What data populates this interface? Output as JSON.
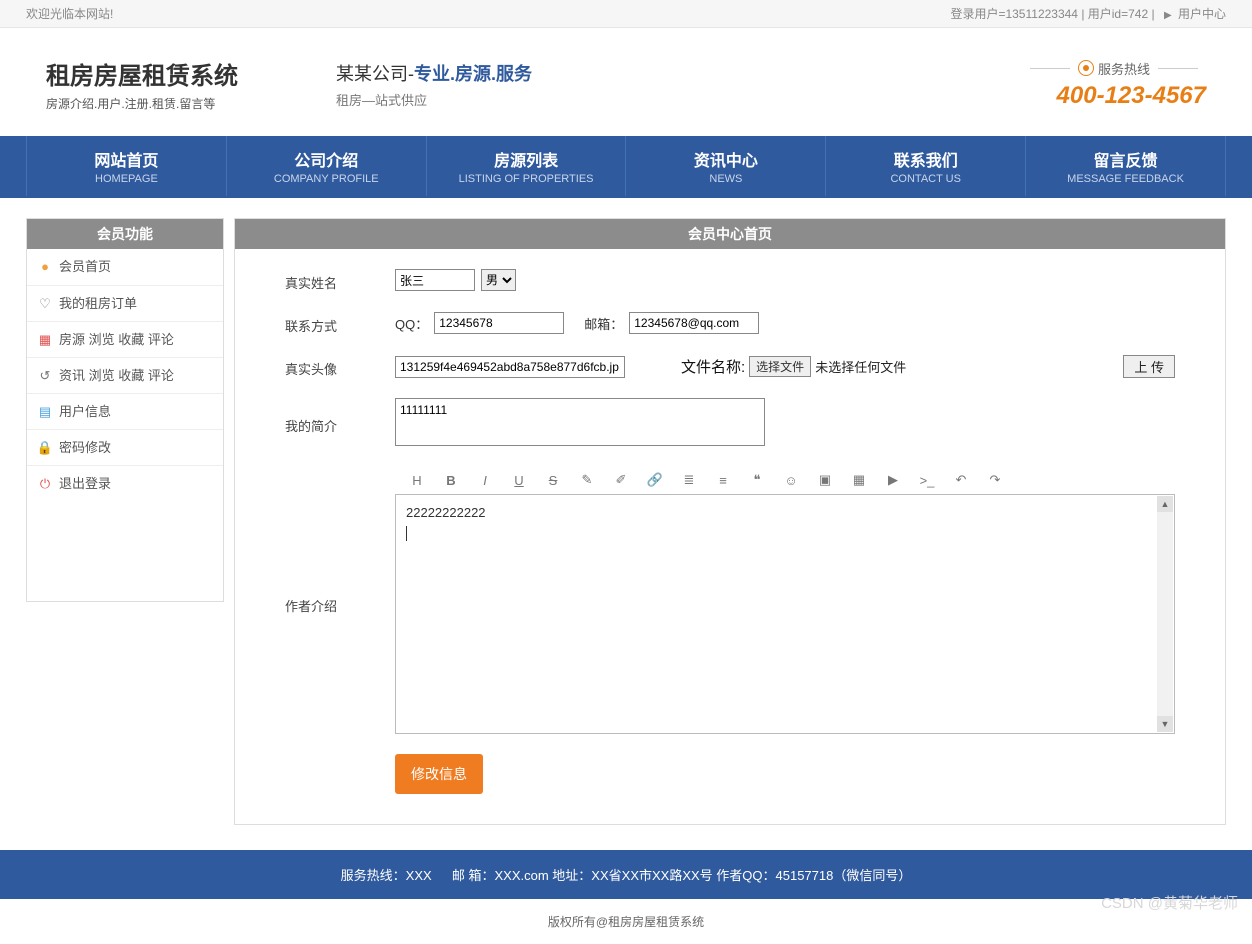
{
  "topbar": {
    "welcome": "欢迎光临本网站!",
    "userinfo": "登录用户=13511223344 | 用户id=742 |",
    "usercenter": "用户中心"
  },
  "header": {
    "title": "租房房屋租赁系统",
    "subtitle": "房源介绍.用户.注册.租赁.留言等",
    "slogan_pre": "某某公司-",
    "slogan_blue": "专业.房源.服务",
    "slogan_sub": "租房—站式供应",
    "hotline_label": "服务热线",
    "hotline_phone": "400-123-4567"
  },
  "nav": [
    {
      "cn": "网站首页",
      "en": "HOMEPAGE"
    },
    {
      "cn": "公司介绍",
      "en": "COMPANY PROFILE"
    },
    {
      "cn": "房源列表",
      "en": "LISTING OF PROPERTIES"
    },
    {
      "cn": "资讯中心",
      "en": "NEWS"
    },
    {
      "cn": "联系我们",
      "en": "CONTACT US"
    },
    {
      "cn": "留言反馈",
      "en": "MESSAGE FEEDBACK"
    }
  ],
  "sidebar": {
    "title": "会员功能",
    "items": [
      {
        "label": "会员首页",
        "color": "#f0a040"
      },
      {
        "label": "我的租房订单",
        "color": "#777"
      },
      {
        "label": "房源 浏览 收藏 评论",
        "color": "#e05050"
      },
      {
        "label": "资讯 浏览 收藏 评论",
        "color": "#777"
      },
      {
        "label": "用户信息",
        "color": "#4aa0e0"
      },
      {
        "label": "密码修改",
        "color": "#f07c22"
      },
      {
        "label": "退出登录",
        "color": "#e05050"
      }
    ]
  },
  "content": {
    "title": "会员中心首页",
    "labels": {
      "realname": "真实姓名",
      "contact": "联系方式",
      "avatar": "真实头像",
      "brief": "我的简介",
      "author": "作者介绍"
    },
    "realname_value": "张三",
    "gender_value": "男",
    "qq_label": "QQ：",
    "qq_value": "12345678",
    "email_label": "邮箱：",
    "email_value": "12345678@qq.com",
    "avatar_value": "131259f4e469452abd8a758e877d6fcb.jp",
    "file_label": "文件名称:",
    "choose_file": "选择文件",
    "no_file": "未选择任何文件",
    "upload": "上 传",
    "brief_value": "11111111",
    "editor_value": "22222222222",
    "submit": "修改信息"
  },
  "footer": {
    "line1": "服务热线：XXX   邮 箱：XXX.com  地址：XX省XX市XX路XX号  作者QQ：45157718（微信同号）",
    "line2": "版权所有@租房房屋租赁系统"
  },
  "watermark": "CSDN @黄菊华老师"
}
